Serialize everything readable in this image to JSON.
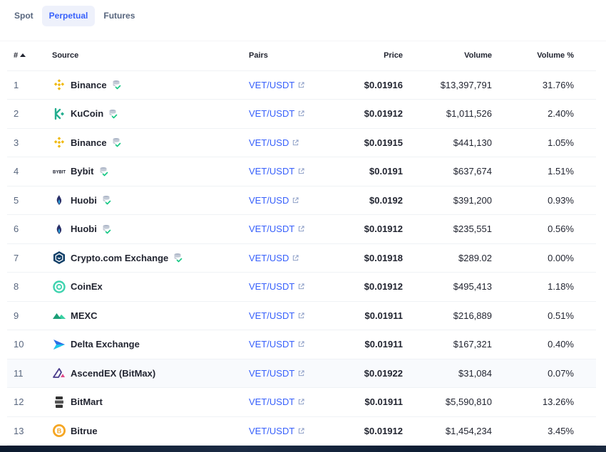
{
  "tabs": [
    {
      "label": "Spot",
      "active": false
    },
    {
      "label": "Perpetual",
      "active": true
    },
    {
      "label": "Futures",
      "active": false
    }
  ],
  "columns": {
    "rank": "#",
    "source": "Source",
    "pairs": "Pairs",
    "price": "Price",
    "volume": "Volume",
    "volume_pct": "Volume %"
  },
  "rows": [
    {
      "rank": "1",
      "source": "Binance",
      "logo": "binance-logo",
      "verified": true,
      "pair": "VET/USDT",
      "price": "$0.01916",
      "volume": "$13,397,791",
      "volume_pct": "31.76%"
    },
    {
      "rank": "2",
      "source": "KuCoin",
      "logo": "kucoin-logo",
      "verified": true,
      "pair": "VET/USDT",
      "price": "$0.01912",
      "volume": "$1,011,526",
      "volume_pct": "2.40%"
    },
    {
      "rank": "3",
      "source": "Binance",
      "logo": "binance-logo",
      "verified": true,
      "pair": "VET/USD",
      "price": "$0.01915",
      "volume": "$441,130",
      "volume_pct": "1.05%"
    },
    {
      "rank": "4",
      "source": "Bybit",
      "logo": "bybit-logo",
      "verified": true,
      "pair": "VET/USDT",
      "price": "$0.0191",
      "volume": "$637,674",
      "volume_pct": "1.51%"
    },
    {
      "rank": "5",
      "source": "Huobi",
      "logo": "huobi-logo",
      "verified": true,
      "pair": "VET/USD",
      "price": "$0.0192",
      "volume": "$391,200",
      "volume_pct": "0.93%"
    },
    {
      "rank": "6",
      "source": "Huobi",
      "logo": "huobi-logo",
      "verified": true,
      "pair": "VET/USDT",
      "price": "$0.01912",
      "volume": "$235,551",
      "volume_pct": "0.56%"
    },
    {
      "rank": "7",
      "source": "Crypto.com Exchange",
      "logo": "cryptocom-logo",
      "verified": true,
      "pair": "VET/USD",
      "price": "$0.01918",
      "volume": "$289.02",
      "volume_pct": "0.00%"
    },
    {
      "rank": "8",
      "source": "CoinEx",
      "logo": "coinex-logo",
      "verified": false,
      "pair": "VET/USDT",
      "price": "$0.01912",
      "volume": "$495,413",
      "volume_pct": "1.18%"
    },
    {
      "rank": "9",
      "source": "MEXC",
      "logo": "mexc-logo",
      "verified": false,
      "pair": "VET/USDT",
      "price": "$0.01911",
      "volume": "$216,889",
      "volume_pct": "0.51%"
    },
    {
      "rank": "10",
      "source": "Delta Exchange",
      "logo": "delta-logo",
      "verified": false,
      "pair": "VET/USDT",
      "price": "$0.01911",
      "volume": "$167,321",
      "volume_pct": "0.40%"
    },
    {
      "rank": "11",
      "source": "AscendEX (BitMax)",
      "logo": "ascendex-logo",
      "verified": false,
      "pair": "VET/USDT",
      "price": "$0.01922",
      "volume": "$31,084",
      "volume_pct": "0.07%",
      "highlight": true
    },
    {
      "rank": "12",
      "source": "BitMart",
      "logo": "bitmart-logo",
      "verified": false,
      "pair": "VET/USDT",
      "price": "$0.01911",
      "volume": "$5,590,810",
      "volume_pct": "13.26%"
    },
    {
      "rank": "13",
      "source": "Bitrue",
      "logo": "bitrue-logo",
      "verified": false,
      "pair": "VET/USDT",
      "price": "$0.01912",
      "volume": "$1,454,234",
      "volume_pct": "3.45%"
    }
  ],
  "colors": {
    "link": "#3861fb",
    "text": "#222531",
    "muted": "#58667e",
    "verified_green": "#16c784"
  }
}
